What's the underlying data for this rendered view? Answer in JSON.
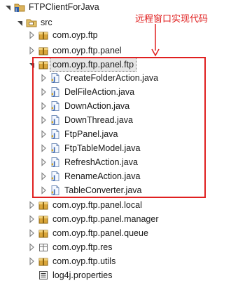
{
  "annotation": {
    "text": "远程窗口实现代码",
    "color": "#e02020"
  },
  "tree": [
    {
      "label": "FTPClientForJava",
      "icon": "java-project-icon",
      "twisty": "expanded",
      "name": "tree-item-ftpclientforjava"
    },
    {
      "label": "src",
      "icon": "source-folder-icon",
      "twisty": "expanded",
      "name": "tree-item-src"
    },
    {
      "label": "com.oyp.ftp",
      "icon": "package-icon",
      "twisty": "collapsed",
      "name": "tree-item-com-oyp-ftp"
    },
    {
      "label": "com.oyp.ftp.panel",
      "icon": "package-icon",
      "twisty": "collapsed",
      "name": "tree-item-com-oyp-ftp-panel"
    },
    {
      "label": "com.oyp.ftp.panel.ftp",
      "icon": "package-icon",
      "twisty": "expanded",
      "name": "tree-item-com-oyp-ftp-panel-ftp",
      "selected": true
    },
    {
      "label": "CreateFolderAction.java",
      "icon": "java-file-icon",
      "twisty": "collapsed",
      "name": "tree-item-createfolderaction"
    },
    {
      "label": "DelFileAction.java",
      "icon": "java-file-icon",
      "twisty": "collapsed",
      "name": "tree-item-delfileaction"
    },
    {
      "label": "DownAction.java",
      "icon": "java-file-icon",
      "twisty": "collapsed",
      "name": "tree-item-downaction"
    },
    {
      "label": "DownThread.java",
      "icon": "java-file-icon",
      "twisty": "collapsed",
      "name": "tree-item-downthread"
    },
    {
      "label": "FtpPanel.java",
      "icon": "java-file-icon",
      "twisty": "collapsed",
      "name": "tree-item-ftppanel"
    },
    {
      "label": "FtpTableModel.java",
      "icon": "java-file-icon",
      "twisty": "collapsed",
      "name": "tree-item-ftptablemodel"
    },
    {
      "label": "RefreshAction.java",
      "icon": "java-file-icon",
      "twisty": "collapsed",
      "name": "tree-item-refreshaction"
    },
    {
      "label": "RenameAction.java",
      "icon": "java-file-icon",
      "twisty": "collapsed",
      "name": "tree-item-renameaction"
    },
    {
      "label": "TableConverter.java",
      "icon": "java-file-icon",
      "twisty": "collapsed",
      "name": "tree-item-tableconverter"
    },
    {
      "label": "com.oyp.ftp.panel.local",
      "icon": "package-icon",
      "twisty": "collapsed",
      "name": "tree-item-com-oyp-ftp-panel-local"
    },
    {
      "label": "com.oyp.ftp.panel.manager",
      "icon": "package-icon",
      "twisty": "collapsed",
      "name": "tree-item-com-oyp-ftp-panel-manager"
    },
    {
      "label": "com.oyp.ftp.panel.queue",
      "icon": "package-icon",
      "twisty": "collapsed",
      "name": "tree-item-com-oyp-ftp-panel-queue"
    },
    {
      "label": "com.oyp.ftp.res",
      "icon": "resource-package-icon",
      "twisty": "collapsed",
      "name": "tree-item-com-oyp-ftp-res"
    },
    {
      "label": "com.oyp.ftp.utils",
      "icon": "package-icon",
      "twisty": "collapsed",
      "name": "tree-item-com-oyp-ftp-utils"
    },
    {
      "label": "log4j.properties",
      "icon": "properties-file-icon",
      "twisty": "none",
      "name": "tree-item-log4j-properties"
    }
  ]
}
